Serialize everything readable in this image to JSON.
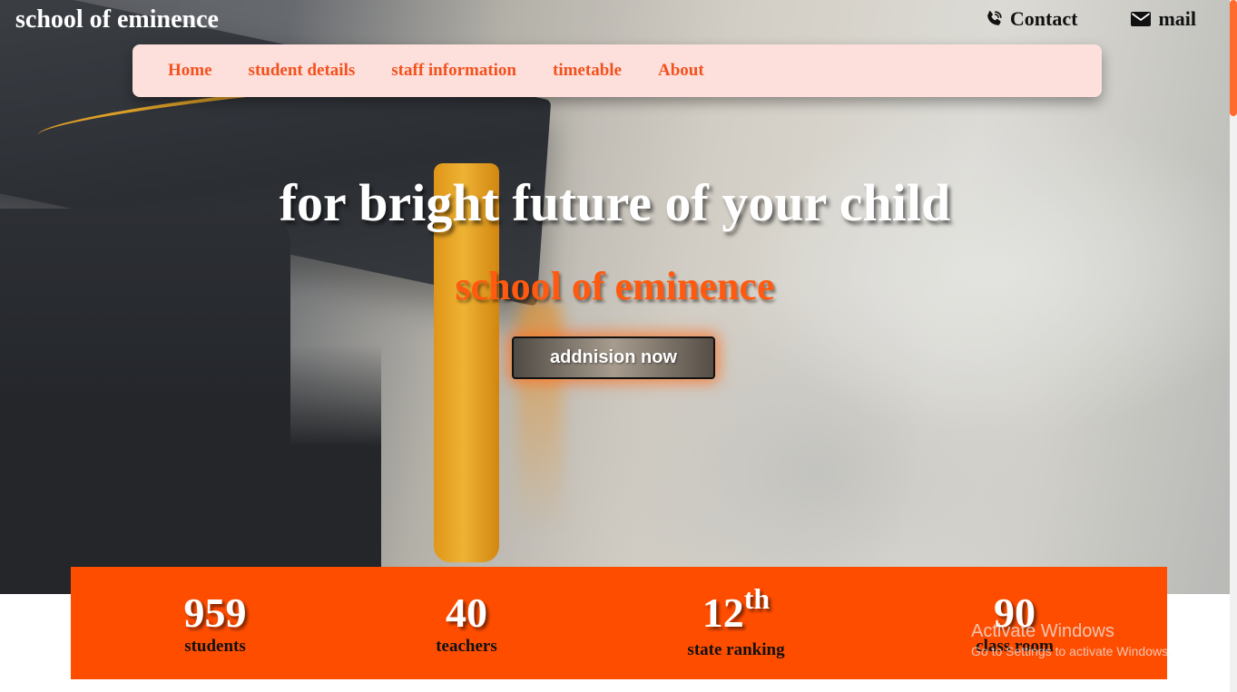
{
  "brand": "school of eminence",
  "top_links": {
    "contact": "Contact",
    "mail": "mail"
  },
  "nav": {
    "items": [
      "Home",
      "student details",
      "staff information",
      "timetable",
      "About"
    ]
  },
  "hero": {
    "headline": "for bright future of your child",
    "subheadline": "school of eminence",
    "cta_label": "addnision now"
  },
  "stats": [
    {
      "value": "959",
      "label": "students"
    },
    {
      "value": "40",
      "label": "teachers"
    },
    {
      "value": "12",
      "suffix": "th",
      "label": "state ranking"
    },
    {
      "value": "90",
      "label": "class room"
    }
  ],
  "watermark": {
    "title": "Activate Windows",
    "subtitle": "Go to Settings to activate Windows."
  },
  "colors": {
    "accent": "#ff4d00",
    "nav_bg": "#fde0db",
    "nav_text": "#f4511e",
    "subhead": "#ff5a0f",
    "scroll_thumb": "#ff6a2e"
  },
  "icons": {
    "contact": "phone-icon",
    "mail": "envelope-icon"
  }
}
